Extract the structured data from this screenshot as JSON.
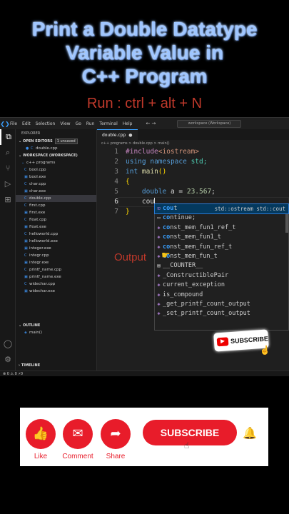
{
  "title": {
    "line1": "Print a Double Datatype",
    "line2": "Variable Value  in",
    "line3": "C++  Program"
  },
  "subtitle": "Run : ctrl + alt + N",
  "vscode": {
    "menu": [
      "File",
      "Edit",
      "Selection",
      "View",
      "Go",
      "Run",
      "Terminal",
      "Help"
    ],
    "search_text": "workspace (Workspace)",
    "explorer_label": "EXPLORER",
    "open_editors_label": "OPEN EDITORS",
    "unsaved_badge": "1 unsaved",
    "open_file": "double.cpp",
    "workspace_label": "WORKSPACE (WORKSPACE)",
    "folder": "c++ programs",
    "files": [
      "bool.cpp",
      "bool.exe",
      "char.cpp",
      "char.exe",
      "double.cpp",
      "first.cpp",
      "first.exe",
      "float.cpp",
      "float.exe",
      "helloworld.cpp",
      "helloworld.exe",
      "integer.exe",
      "integr.cpp",
      "integr.exe",
      "printf_name.cpp",
      "printf_name.exe",
      "widechar.cpp",
      "widechar.exe"
    ],
    "outline_label": "OUTLINE",
    "outline_item": "main()",
    "timeline_label": "TIMELINE",
    "tab_label": "double.cpp",
    "breadcrumb": "c++ programs > double.cpp > main()",
    "code_lines": [
      {
        "n": "1"
      },
      {
        "n": "2"
      },
      {
        "n": "3"
      },
      {
        "n": "4"
      },
      {
        "n": "5"
      },
      {
        "n": "6"
      },
      {
        "n": "7"
      }
    ],
    "code": {
      "l1_pp": "#include",
      "l1_inc": "<iostream>",
      "l2_kw1": "using",
      "l2_kw2": "namespace",
      "l2_ns": "std;",
      "l3_kw": "int",
      "l3_fn": "main",
      "l3_rest": "()",
      "l4": "{",
      "l5_kw": "double",
      "l5_rest": "a = ",
      "l5_num": "23.567",
      "l5_end": ";",
      "l6": "cou",
      "l7": "}"
    },
    "suggestions": [
      {
        "match": "cou",
        "rest": "t",
        "detail": "std::ostream std::cout",
        "icon": "variable-icon"
      },
      {
        "match": "co",
        "rest": "ntinue;",
        "detail": "",
        "icon": "snippet-icon"
      },
      {
        "match": "co",
        "rest": "nst_mem_fun1_ref_t",
        "detail": "",
        "icon": "class-icon"
      },
      {
        "match": "co",
        "rest": "nst_mem_fun1_t",
        "detail": "",
        "icon": "class-icon"
      },
      {
        "match": "co",
        "rest": "nst_mem_fun_ref_t",
        "detail": "",
        "icon": "class-icon"
      },
      {
        "match": "co",
        "rest": "nst_mem_fun_t",
        "detail": "",
        "icon": "class-icon"
      },
      {
        "match": "",
        "rest": "__COUNTER__",
        "detail": "",
        "icon": "constant-icon"
      },
      {
        "match": "",
        "rest": "_ConstructiblePair",
        "detail": "",
        "icon": "class-icon"
      },
      {
        "match": "",
        "rest": "current_exception",
        "detail": "",
        "icon": "function-icon"
      },
      {
        "match": "",
        "rest": "is_compound",
        "detail": "",
        "icon": "class-icon"
      },
      {
        "match": "",
        "rest": "_get_printf_count_output",
        "detail": "",
        "icon": "function-icon"
      },
      {
        "match": "",
        "rest": "_set_printf_count_output",
        "detail": "",
        "icon": "function-icon"
      }
    ],
    "status": "⊗ 0 ⚠ 0   ⚡0"
  },
  "output_label": "Output",
  "subscribe_badge": "SUBSCRIBE",
  "bottom": {
    "like": "Like",
    "comment": "Comment",
    "share": "Share",
    "subscribe": "SUBSCRIBE"
  },
  "colors": {
    "accent_red": "#e81c2a",
    "title_blue": "#9fc6ff",
    "editor_bg": "#1f1f1f"
  }
}
